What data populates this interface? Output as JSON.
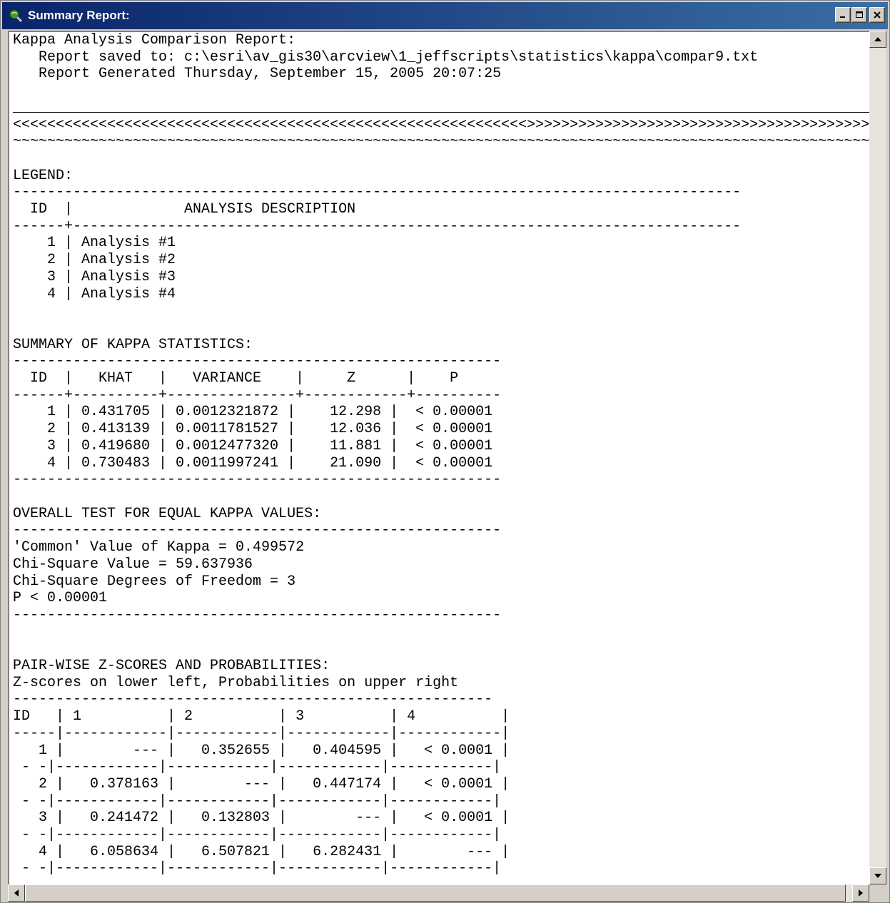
{
  "window": {
    "title": "Summary Report:"
  },
  "report": {
    "lines": [
      "Kappa Analysis Comparison Report:",
      "   Report saved to: c:\\esri\\av_gis30\\arcview\\1_jeffscripts\\statistics\\kappa\\compar9.txt",
      "   Report Generated Thursday, September 15, 2005 20:07:25",
      "",
      "_____________________________________________________________________________________________________________________________",
      "<<<<<<<<<<<<<<<<<<<<<<<<<<<<<<<<<<<<<<<<<<<<<<<<<<<<<<<<<<<<>>>>>>>>>>>>>>>>>>>>>>>>>>>>>>>>>>>>>>>>>>>>>>>>>>>>>>>>>>>>>>>",
      "~~~~~~~~~~~~~~~~~~~~~~~~~~~~~~~~~~~~~~~~~~~~~~~~~~~~~~~~~~~~~~~~~~~~~~~~~~~~~~~~~~~~~~~~~~~~~~~~~~~~~~~~~~~~~~~~~~~~~~~~~~",
      "",
      "LEGEND:",
      "-------------------------------------------------------------------------------------",
      "  ID  |             ANALYSIS DESCRIPTION",
      "------+------------------------------------------------------------------------------",
      "    1 | Analysis #1",
      "    2 | Analysis #2",
      "    3 | Analysis #3",
      "    4 | Analysis #4",
      "",
      "",
      "SUMMARY OF KAPPA STATISTICS:",
      "---------------------------------------------------------",
      "  ID  |   KHAT   |   VARIANCE    |     Z      |    P",
      "------+----------+---------------+------------+----------",
      "    1 | 0.431705 | 0.0012321872 |    12.298 |  < 0.00001",
      "    2 | 0.413139 | 0.0011781527 |    12.036 |  < 0.00001",
      "    3 | 0.419680 | 0.0012477320 |    11.881 |  < 0.00001",
      "    4 | 0.730483 | 0.0011997241 |    21.090 |  < 0.00001",
      "---------------------------------------------------------",
      "",
      "OVERALL TEST FOR EQUAL KAPPA VALUES:",
      "---------------------------------------------------------",
      "'Common' Value of Kappa = 0.499572",
      "Chi-Square Value = 59.637936",
      "Chi-Square Degrees of Freedom = 3",
      "P < 0.00001",
      "---------------------------------------------------------",
      "",
      "",
      "PAIR-WISE Z-SCORES AND PROBABILITIES:",
      "Z-scores on lower left, Probabilities on upper right",
      "--------------------------------------------------------",
      "ID   | 1          | 2          | 3          | 4          |",
      "-----|------------|------------|------------|------------|",
      "   1 |        --- |   0.352655 |   0.404595 |   < 0.0001 |",
      " - -|------------|------------|------------|------------|",
      "   2 |   0.378163 |        --- |   0.447174 |   < 0.0001 |",
      " - -|------------|------------|------------|------------|",
      "   3 |   0.241472 |   0.132803 |        --- |   < 0.0001 |",
      " - -|------------|------------|------------|------------|",
      "   4 |   6.058634 |   6.507821 |   6.282431 |        --- |",
      " - -|------------|------------|------------|------------|"
    ]
  },
  "icons": {
    "app": "globe-magnifier-icon",
    "minimize": "minimize-icon",
    "maximize": "maximize-icon",
    "close": "close-icon"
  },
  "colors": {
    "titlebar_start": "#0a246a",
    "titlebar_end": "#3a6ea5",
    "chrome": "#d4d0c8"
  }
}
